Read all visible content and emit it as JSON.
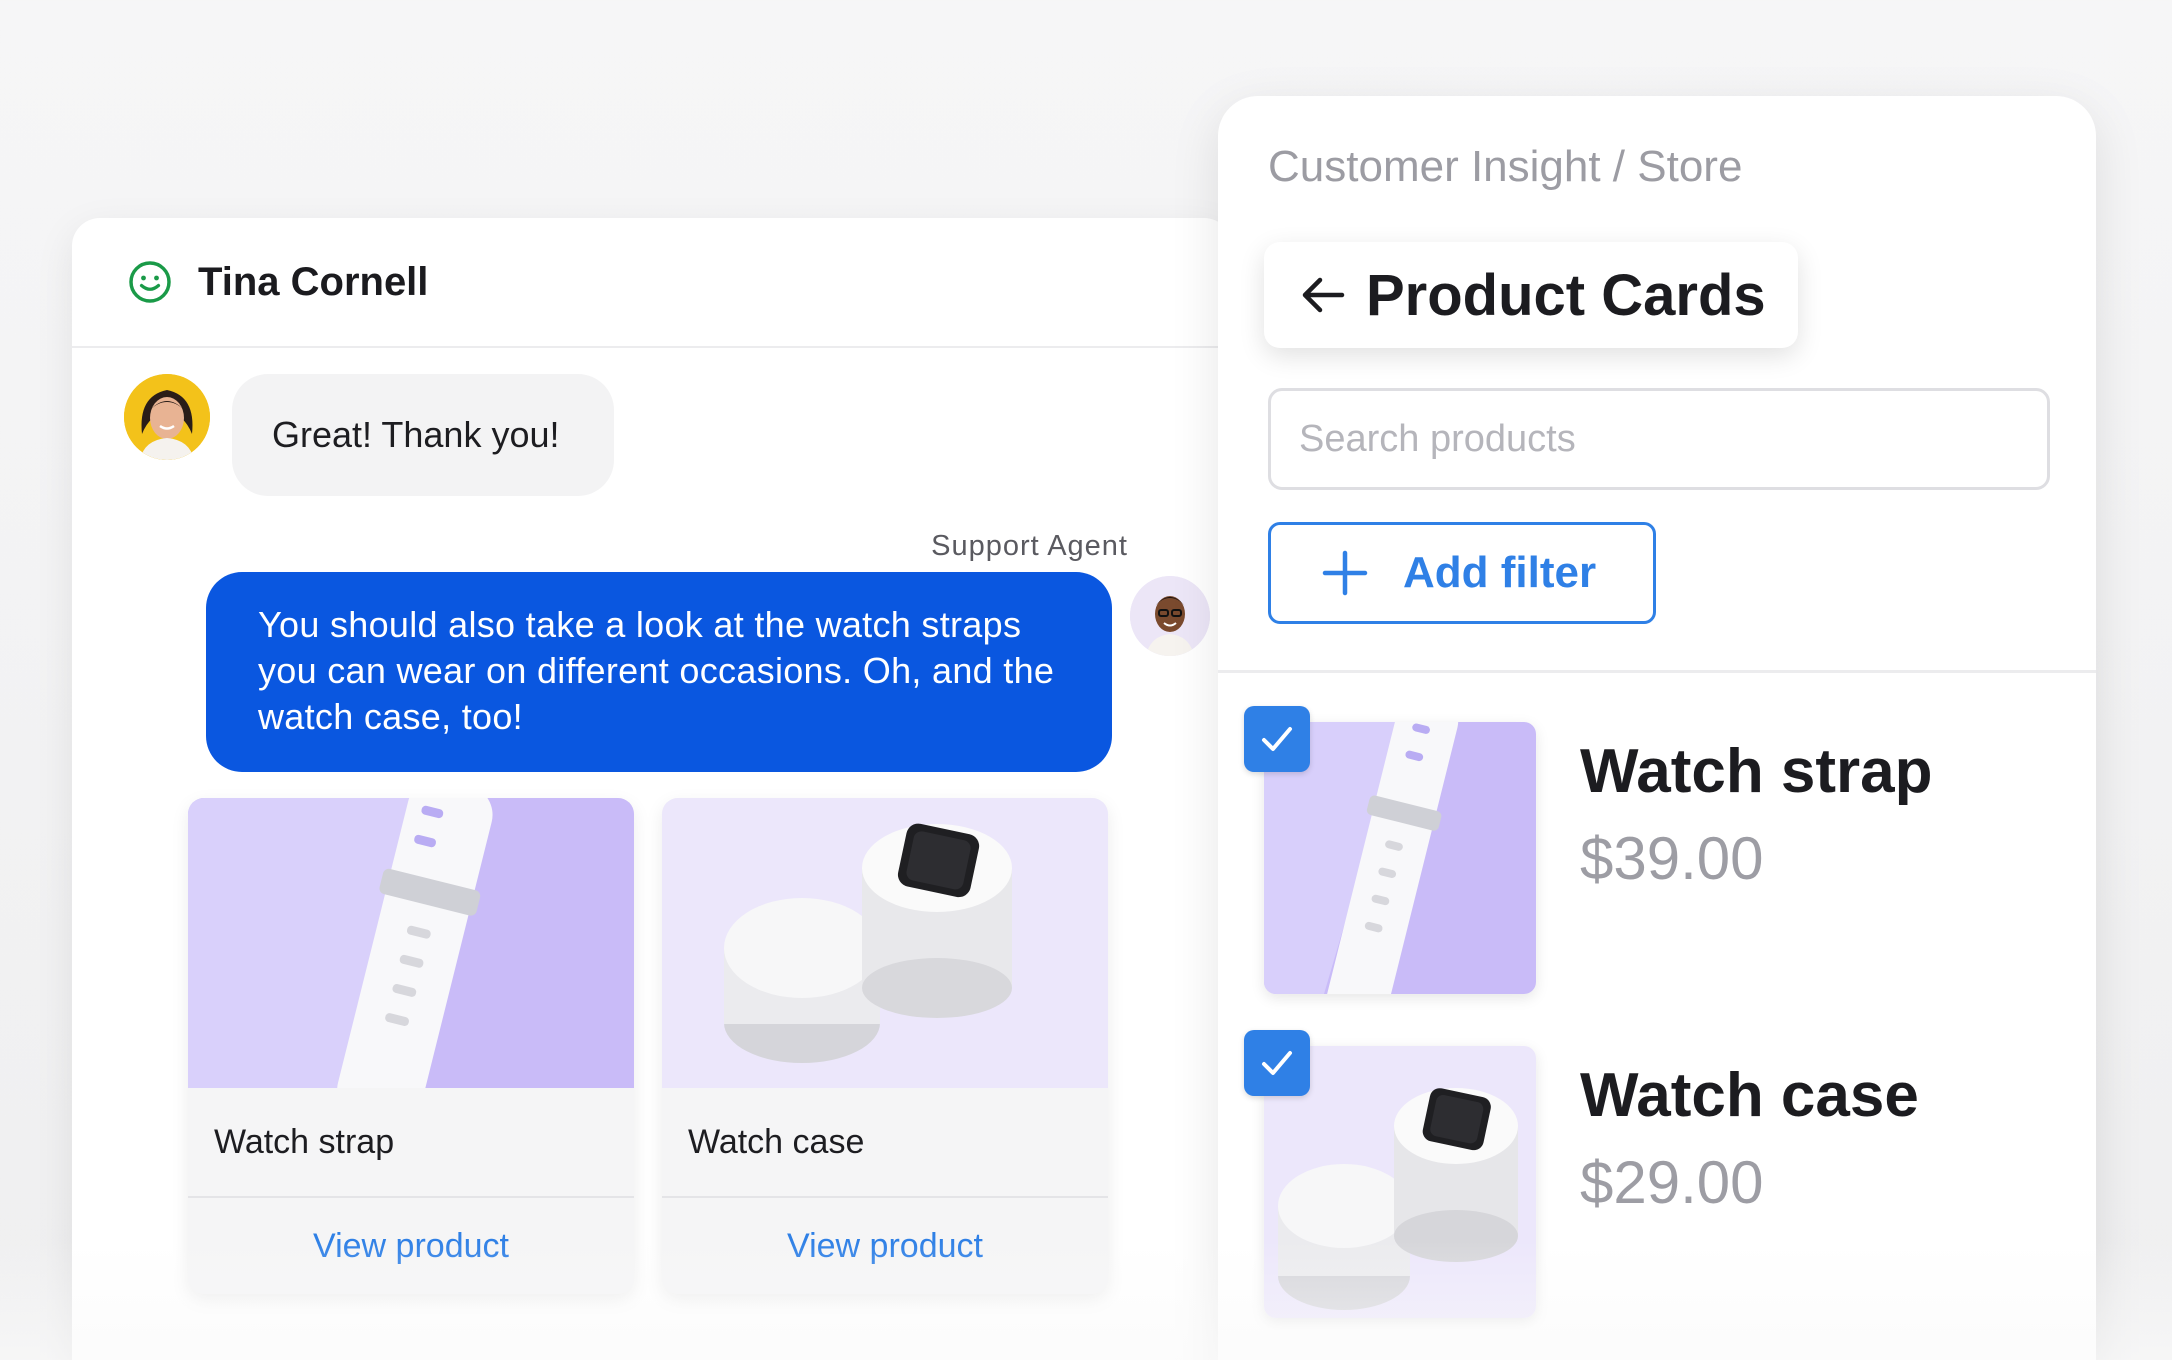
{
  "chat": {
    "contact_name": "Tina Cornell",
    "messages": {
      "customer": "Great! Thank you!",
      "agent_label": "Support Agent",
      "agent_text": "You should also take a look at the watch straps you can wear on different occasions. Oh, and the watch case, too!"
    },
    "cards": [
      {
        "name": "Watch strap",
        "link": "View product"
      },
      {
        "name": "Watch case",
        "link": "View product"
      }
    ]
  },
  "products_panel": {
    "breadcrumb": "Customer Insight / Store",
    "title": "Product Cards",
    "search_placeholder": "Search products",
    "add_filter_label": "Add filter",
    "items": [
      {
        "name": "Watch strap",
        "price": "$39.00",
        "checked": true
      },
      {
        "name": "Watch case",
        "price": "$29.00",
        "checked": true
      }
    ]
  },
  "colors": {
    "accent_blue": "#2f80e6",
    "agent_bubble": "#0a57e0",
    "status_green": "#1a9a48",
    "thumb_purple": "#c7b9f7",
    "thumb_lavender": "#ece7fb"
  }
}
